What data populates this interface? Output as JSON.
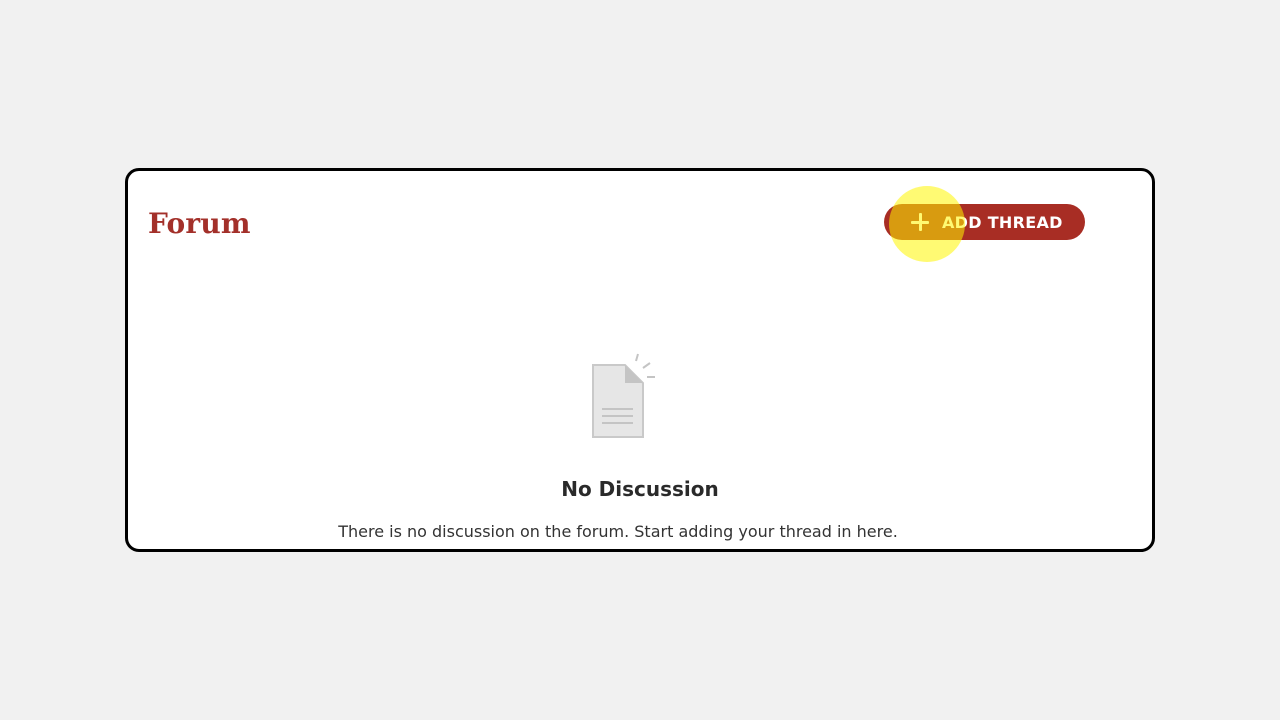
{
  "forum": {
    "title": "Forum",
    "add_button_label": "ADD THREAD",
    "add_button_icon": "plus-icon"
  },
  "empty_state": {
    "icon": "document-icon",
    "title": "No Discussion",
    "description": "There is no discussion on the forum. Start adding your thread in here."
  },
  "colors": {
    "brand": "#a82d24",
    "title": "#a3302a",
    "background": "#f1f1f1",
    "cursor_highlight": "#fff500"
  }
}
